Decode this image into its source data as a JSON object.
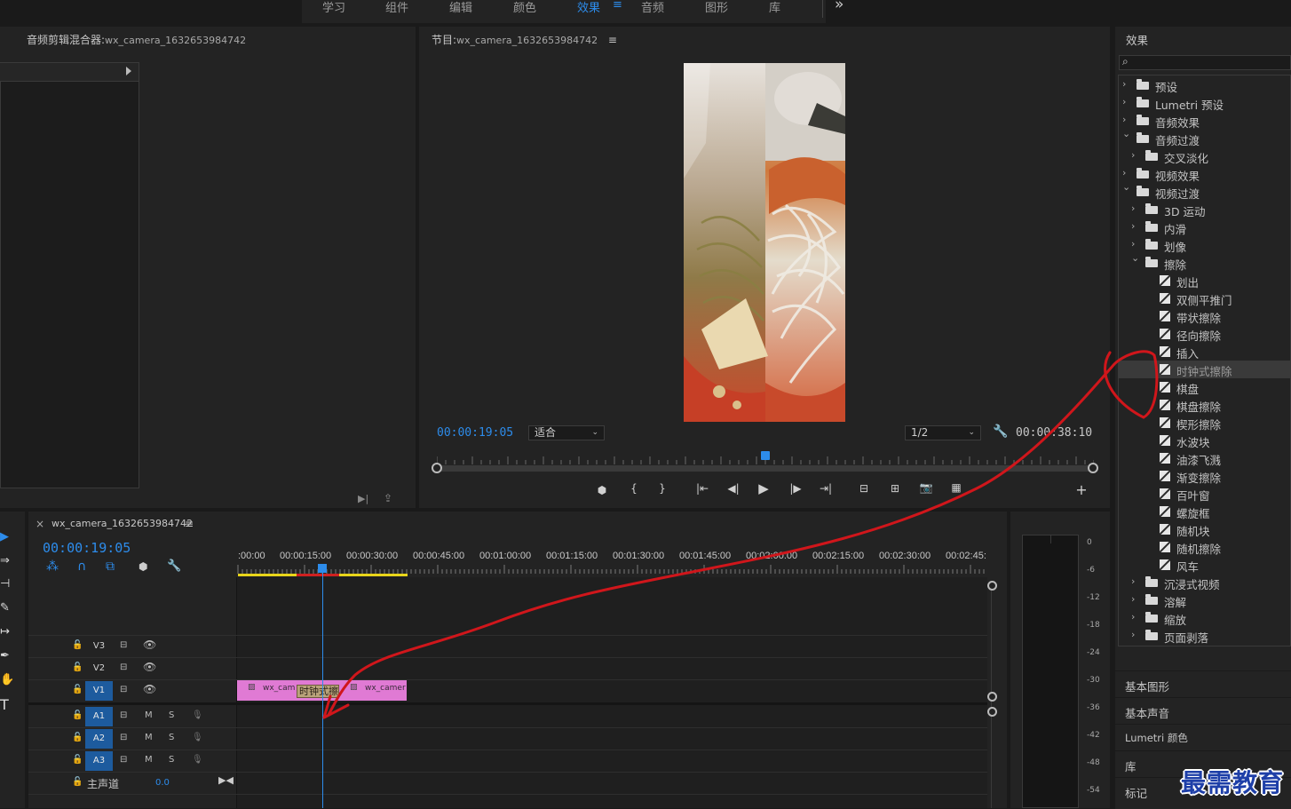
{
  "nav": {
    "items": [
      "学习",
      "组件",
      "编辑",
      "颜色",
      "效果",
      "音频",
      "图形",
      "库"
    ],
    "active": "效果",
    "more": "»",
    "menu_glyph": "≡"
  },
  "audio_mixer": {
    "title": "音频剪辑混合器:",
    "clip": "wx_camera_1632653984742"
  },
  "program": {
    "title": "节目:",
    "sequence": "wx_camera_1632653984742",
    "menu_glyph": "≡",
    "timecode": "00:00:19:05",
    "fit": "适合",
    "resolution": "1/2",
    "duration": "00:00:38:10",
    "playhead_progress": 0.5
  },
  "timeline": {
    "close": "×",
    "tab": "wx_camera_1632653984742",
    "menu_glyph": "≡",
    "timecode": "00:00:19:05",
    "ruler": [
      ":00:00",
      "00:00:15:00",
      "00:00:30:00",
      "00:00:45:00",
      "00:01:00:00",
      "00:01:15:00",
      "00:01:30:00",
      "00:01:45:00",
      "00:02:00:00",
      "00:02:15:00",
      "00:02:30:00",
      "00:02:45:"
    ],
    "tracks": [
      {
        "name": "V3",
        "on": false,
        "type": "video"
      },
      {
        "name": "V2",
        "on": false,
        "type": "video"
      },
      {
        "name": "V1",
        "on": true,
        "type": "video"
      },
      {
        "name": "A1",
        "on": true,
        "type": "audio"
      },
      {
        "name": "A2",
        "on": true,
        "type": "audio"
      },
      {
        "name": "A3",
        "on": true,
        "type": "audio"
      }
    ],
    "mute": "M",
    "solo": "S",
    "master": {
      "label": "主声道",
      "value": "0.0"
    },
    "clips": {
      "clip_a": "wx_cam",
      "transition": "时钟式擦",
      "clip_b": "wx_camer"
    }
  },
  "vu_scale": [
    "0",
    "-6",
    "-12",
    "-18",
    "-24",
    "-30",
    "-36",
    "-42",
    "-48",
    "-54"
  ],
  "effects": {
    "title": "效果",
    "search_placeholder": "",
    "tree": [
      {
        "label": "预设",
        "depth": 0,
        "kind": "preset",
        "chev": "›"
      },
      {
        "label": "Lumetri 预设",
        "depth": 0,
        "kind": "preset",
        "chev": "›"
      },
      {
        "label": "音频效果",
        "depth": 0,
        "kind": "folder",
        "chev": "›"
      },
      {
        "label": "音频过渡",
        "depth": 0,
        "kind": "folder",
        "chev": "⌄"
      },
      {
        "label": "交叉淡化",
        "depth": 1,
        "kind": "folder",
        "chev": "›"
      },
      {
        "label": "视频效果",
        "depth": 0,
        "kind": "folder",
        "chev": "›"
      },
      {
        "label": "视频过渡",
        "depth": 0,
        "kind": "folder",
        "chev": "⌄"
      },
      {
        "label": "3D 运动",
        "depth": 1,
        "kind": "folder",
        "chev": "›"
      },
      {
        "label": "内滑",
        "depth": 1,
        "kind": "folder",
        "chev": "›"
      },
      {
        "label": "划像",
        "depth": 1,
        "kind": "folder",
        "chev": "›"
      },
      {
        "label": "擦除",
        "depth": 1,
        "kind": "folder",
        "chev": "⌄"
      },
      {
        "label": "划出",
        "depth": 2,
        "kind": "fx",
        "chev": ""
      },
      {
        "label": "双侧平推门",
        "depth": 2,
        "kind": "fx",
        "chev": ""
      },
      {
        "label": "带状擦除",
        "depth": 2,
        "kind": "fx",
        "chev": ""
      },
      {
        "label": "径向擦除",
        "depth": 2,
        "kind": "fx",
        "chev": ""
      },
      {
        "label": "插入",
        "depth": 2,
        "kind": "fx",
        "chev": ""
      },
      {
        "label": "时钟式擦除",
        "depth": 2,
        "kind": "fx",
        "chev": "",
        "selected": true
      },
      {
        "label": "棋盘",
        "depth": 2,
        "kind": "fx",
        "chev": ""
      },
      {
        "label": "棋盘擦除",
        "depth": 2,
        "kind": "fx",
        "chev": ""
      },
      {
        "label": "楔形擦除",
        "depth": 2,
        "kind": "fx",
        "chev": ""
      },
      {
        "label": "水波块",
        "depth": 2,
        "kind": "fx",
        "chev": ""
      },
      {
        "label": "油漆飞溅",
        "depth": 2,
        "kind": "fx",
        "chev": ""
      },
      {
        "label": "渐变擦除",
        "depth": 2,
        "kind": "fx",
        "chev": ""
      },
      {
        "label": "百叶窗",
        "depth": 2,
        "kind": "fx",
        "chev": ""
      },
      {
        "label": "螺旋框",
        "depth": 2,
        "kind": "fx",
        "chev": ""
      },
      {
        "label": "随机块",
        "depth": 2,
        "kind": "fx",
        "chev": ""
      },
      {
        "label": "随机擦除",
        "depth": 2,
        "kind": "fx",
        "chev": ""
      },
      {
        "label": "风车",
        "depth": 2,
        "kind": "fx",
        "chev": ""
      },
      {
        "label": "沉浸式视频",
        "depth": 1,
        "kind": "folder",
        "chev": "›"
      },
      {
        "label": "溶解",
        "depth": 1,
        "kind": "folder",
        "chev": "›"
      },
      {
        "label": "缩放",
        "depth": 1,
        "kind": "folder",
        "chev": "›"
      },
      {
        "label": "页面剥落",
        "depth": 1,
        "kind": "folder",
        "chev": "›"
      }
    ]
  },
  "right_panels": [
    "基本图形",
    "基本声音",
    "Lumetri 颜色",
    "库",
    "标记"
  ],
  "watermark": "最需教育",
  "colors": {
    "accent": "#2d8ceb",
    "clip": "#e07ad4",
    "annotation": "#d0161b"
  }
}
